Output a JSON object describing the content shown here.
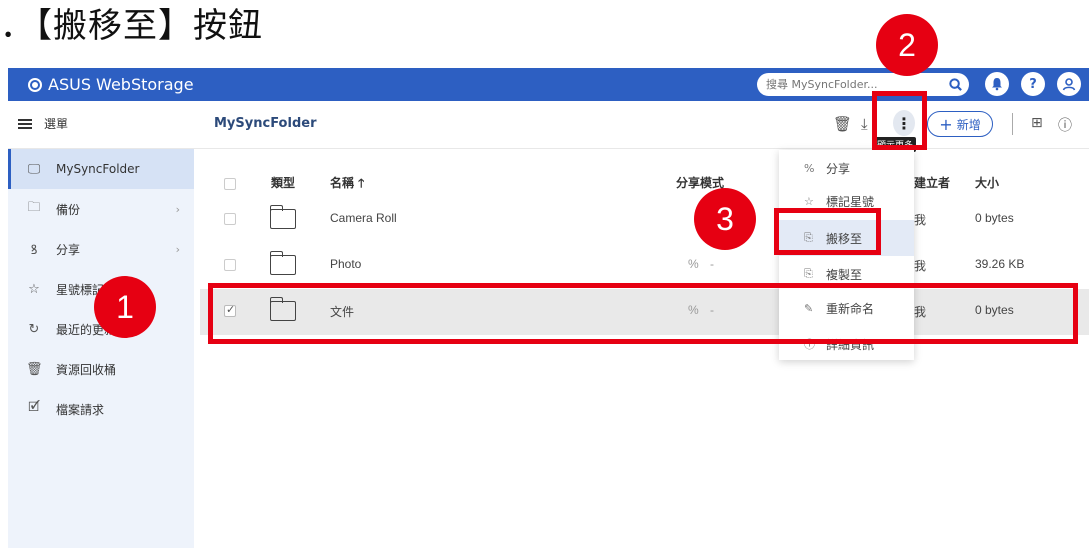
{
  "caption": "．【搬移至】按鈕",
  "topbar": {
    "brand": "ASUS WebStorage",
    "search_placeholder": "搜尋 MySyncFolder...",
    "icons": [
      "search-icon",
      "bell-icon",
      "help-icon",
      "user-icon"
    ],
    "color": "#2d5fc2"
  },
  "subbar": {
    "menu_label": "選單",
    "folder_title": "MySyncFolder",
    "tooltip": "顯示更多",
    "new_label": "新增"
  },
  "sidebar": {
    "items": [
      {
        "label": "MySyncFolder",
        "icon": "computer-icon"
      },
      {
        "label": "備份",
        "icon": "backup-icon"
      },
      {
        "label": "分享",
        "icon": "share-people-icon"
      },
      {
        "label": "星號標記",
        "icon": "star-icon"
      },
      {
        "label": "最近的更新",
        "icon": "refresh-icon"
      },
      {
        "label": "資源回收桶",
        "icon": "trash-icon"
      },
      {
        "label": "檔案請求",
        "icon": "file-request-icon"
      }
    ]
  },
  "table": {
    "headers": {
      "type": "類型",
      "name": "名稱 🡑",
      "share": "分享模式",
      "creator": "建立者",
      "size": "大小"
    },
    "rows": [
      {
        "name": "Camera Roll",
        "share": "",
        "creator": "我",
        "size": "0 bytes",
        "checked": false
      },
      {
        "name": "Photo",
        "share": "-",
        "creator": "我",
        "size": "39.26 KB",
        "checked": false
      },
      {
        "name": "文件",
        "share": "-",
        "creator": "我",
        "size": "0 bytes",
        "checked": true
      }
    ]
  },
  "dropdown": {
    "items": [
      {
        "label": "分享",
        "icon": "link-icon"
      },
      {
        "label": "標記星號",
        "icon": "star-icon"
      },
      {
        "label": "搬移至",
        "icon": "move-icon"
      },
      {
        "label": "複製至",
        "icon": "copy-icon"
      },
      {
        "label": "重新命名",
        "icon": "pencil-icon"
      },
      {
        "label": "詳細資訊",
        "icon": "info-icon"
      }
    ]
  },
  "annotations": {
    "badges": [
      "1",
      "2",
      "3"
    ],
    "color": "#e60012"
  }
}
